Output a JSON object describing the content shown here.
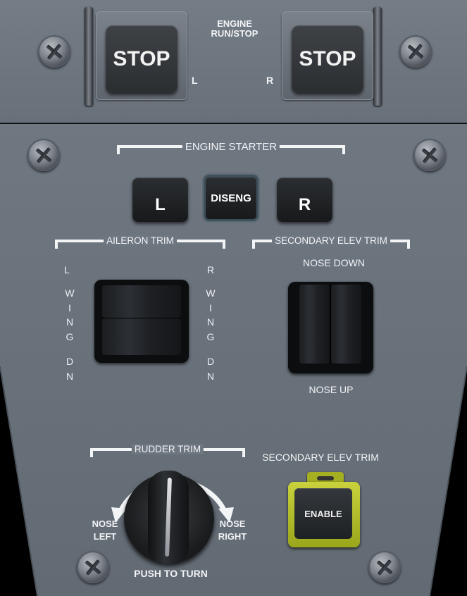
{
  "engine_run_stop": {
    "title_line1": "ENGINE",
    "title_line2": "RUN/STOP",
    "left_button": "STOP",
    "right_button": "STOP",
    "left_tag": "L",
    "right_tag": "R"
  },
  "engine_starter": {
    "title": "ENGINE STARTER",
    "left_button": "L",
    "center_button": "DISENG",
    "right_button": "R"
  },
  "aileron_trim": {
    "title": "AILERON TRIM",
    "left_top": "L",
    "right_top": "R",
    "left_wing": [
      "W",
      "I",
      "N",
      "G"
    ],
    "right_wing": [
      "W",
      "I",
      "N",
      "G"
    ],
    "left_dn": [
      "D",
      "N"
    ],
    "right_dn": [
      "D",
      "N"
    ]
  },
  "secondary_elev_trim": {
    "title": "SECONDARY ELEV TRIM",
    "nose_down": "NOSE DOWN",
    "nose_up": "NOSE UP"
  },
  "rudder_trim": {
    "title": "RUDDER TRIM",
    "nose_left_1": "NOSE",
    "nose_left_2": "LEFT",
    "nose_right_1": "NOSE",
    "nose_right_2": "RIGHT",
    "push_to_turn": "PUSH TO TURN"
  },
  "elev_trim_enable": {
    "title": "SECONDARY ELEV TRIM",
    "button": "ENABLE"
  },
  "colors": {
    "panel": "#6e7680",
    "label": "#f2f4f6",
    "guard_yellow": "#c9d23c",
    "button_dark": "#1b1d1f"
  }
}
